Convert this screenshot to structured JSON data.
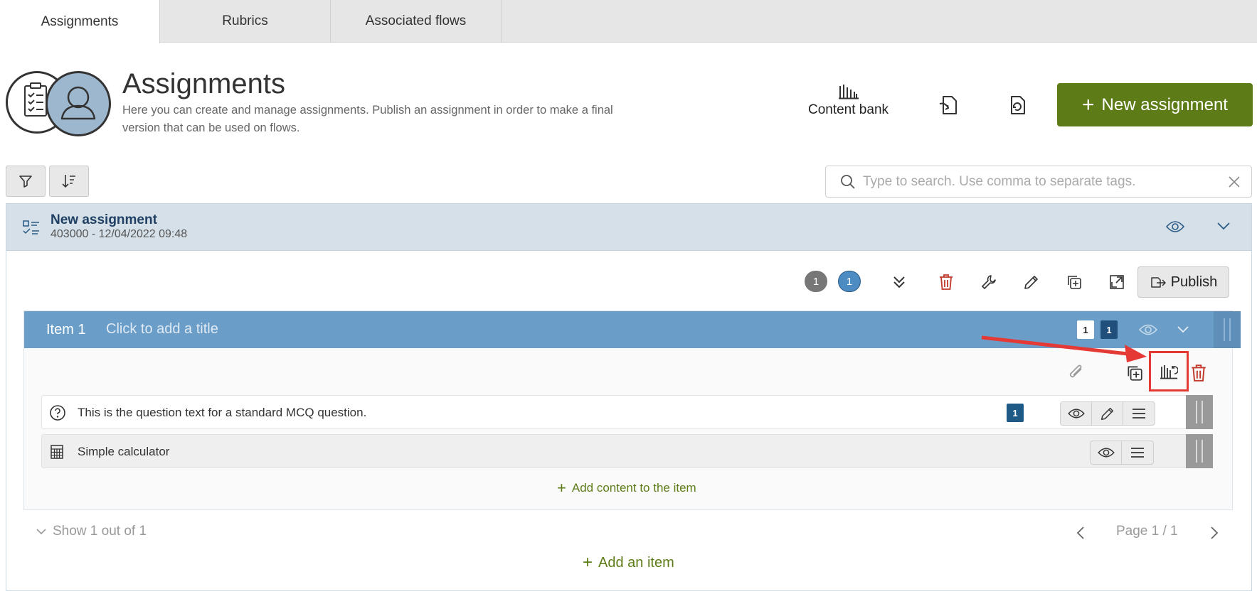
{
  "tabs": [
    {
      "label": "Assignments",
      "active": true
    },
    {
      "label": "Rubrics",
      "active": false
    },
    {
      "label": "Associated flows",
      "active": false
    }
  ],
  "header": {
    "title": "Assignments",
    "description": "Here you can create and manage assignments. Publish an assignment in order to make a final version that can be used on flows.",
    "content_bank_label": "Content bank",
    "new_assignment_label": "New assignment",
    "new_assignment_plus": "+"
  },
  "search": {
    "placeholder": "Type to search. Use comma to separate tags."
  },
  "assignment": {
    "title": "New assignment",
    "subtitle": "403000 - 12/04/2022 09:48",
    "count_gray": "1",
    "count_blue": "1",
    "publish_label": "Publish"
  },
  "item": {
    "number_label": "Item 1",
    "title_placeholder": "Click to add a title",
    "badge_white": "1",
    "badge_dark": "1",
    "contents": [
      {
        "text": "This is the question text for a standard MCQ question.",
        "badge": "1",
        "icon": "question-circle-icon"
      },
      {
        "text": "Simple calculator",
        "icon": "calculator-icon"
      }
    ],
    "add_content_label": "Add content to the item",
    "add_plus": "+"
  },
  "footer": {
    "show_label": "Show 1 out of 1",
    "page_label": "Page 1 / 1",
    "add_item_label": "Add an item",
    "add_plus": "+"
  },
  "colors": {
    "accent_green": "#5d7c17",
    "header_blue": "#d5e0e8",
    "item_blue": "#6a9ec8",
    "badge_dark": "#2a5a86",
    "delete_red": "#c0392b",
    "highlight_red": "#e53935"
  }
}
